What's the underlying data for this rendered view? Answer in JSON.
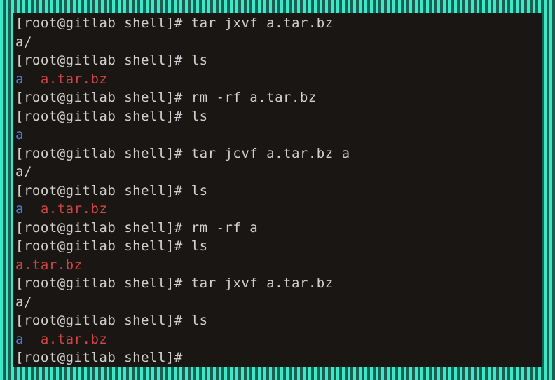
{
  "terminal": {
    "prompt": "[root@gitlab shell]# ",
    "lines": [
      {
        "type": "cmd",
        "text": "tar jxvf a.tar.bz"
      },
      {
        "type": "output",
        "text": "a/"
      },
      {
        "type": "cmd",
        "text": "ls"
      },
      {
        "type": "ls",
        "dir": "a",
        "sep": "  ",
        "archive": "a.tar.bz"
      },
      {
        "type": "cmd",
        "text": "rm -rf a.tar.bz"
      },
      {
        "type": "cmd",
        "text": "ls"
      },
      {
        "type": "ls",
        "dir": "a",
        "sep": "",
        "archive": ""
      },
      {
        "type": "cmd",
        "text": "tar jcvf a.tar.bz a"
      },
      {
        "type": "output",
        "text": "a/"
      },
      {
        "type": "cmd",
        "text": "ls"
      },
      {
        "type": "ls",
        "dir": "a",
        "sep": "  ",
        "archive": "a.tar.bz"
      },
      {
        "type": "cmd",
        "text": "rm -rf a"
      },
      {
        "type": "cmd",
        "text": "ls"
      },
      {
        "type": "ls",
        "dir": "",
        "sep": "",
        "archive": "a.tar.bz"
      },
      {
        "type": "cmd",
        "text": "tar jxvf a.tar.bz"
      },
      {
        "type": "output",
        "text": "a/"
      },
      {
        "type": "cmd",
        "text": "ls"
      },
      {
        "type": "ls",
        "dir": "a",
        "sep": "  ",
        "archive": "a.tar.bz"
      },
      {
        "type": "cmd",
        "text": ""
      }
    ]
  }
}
